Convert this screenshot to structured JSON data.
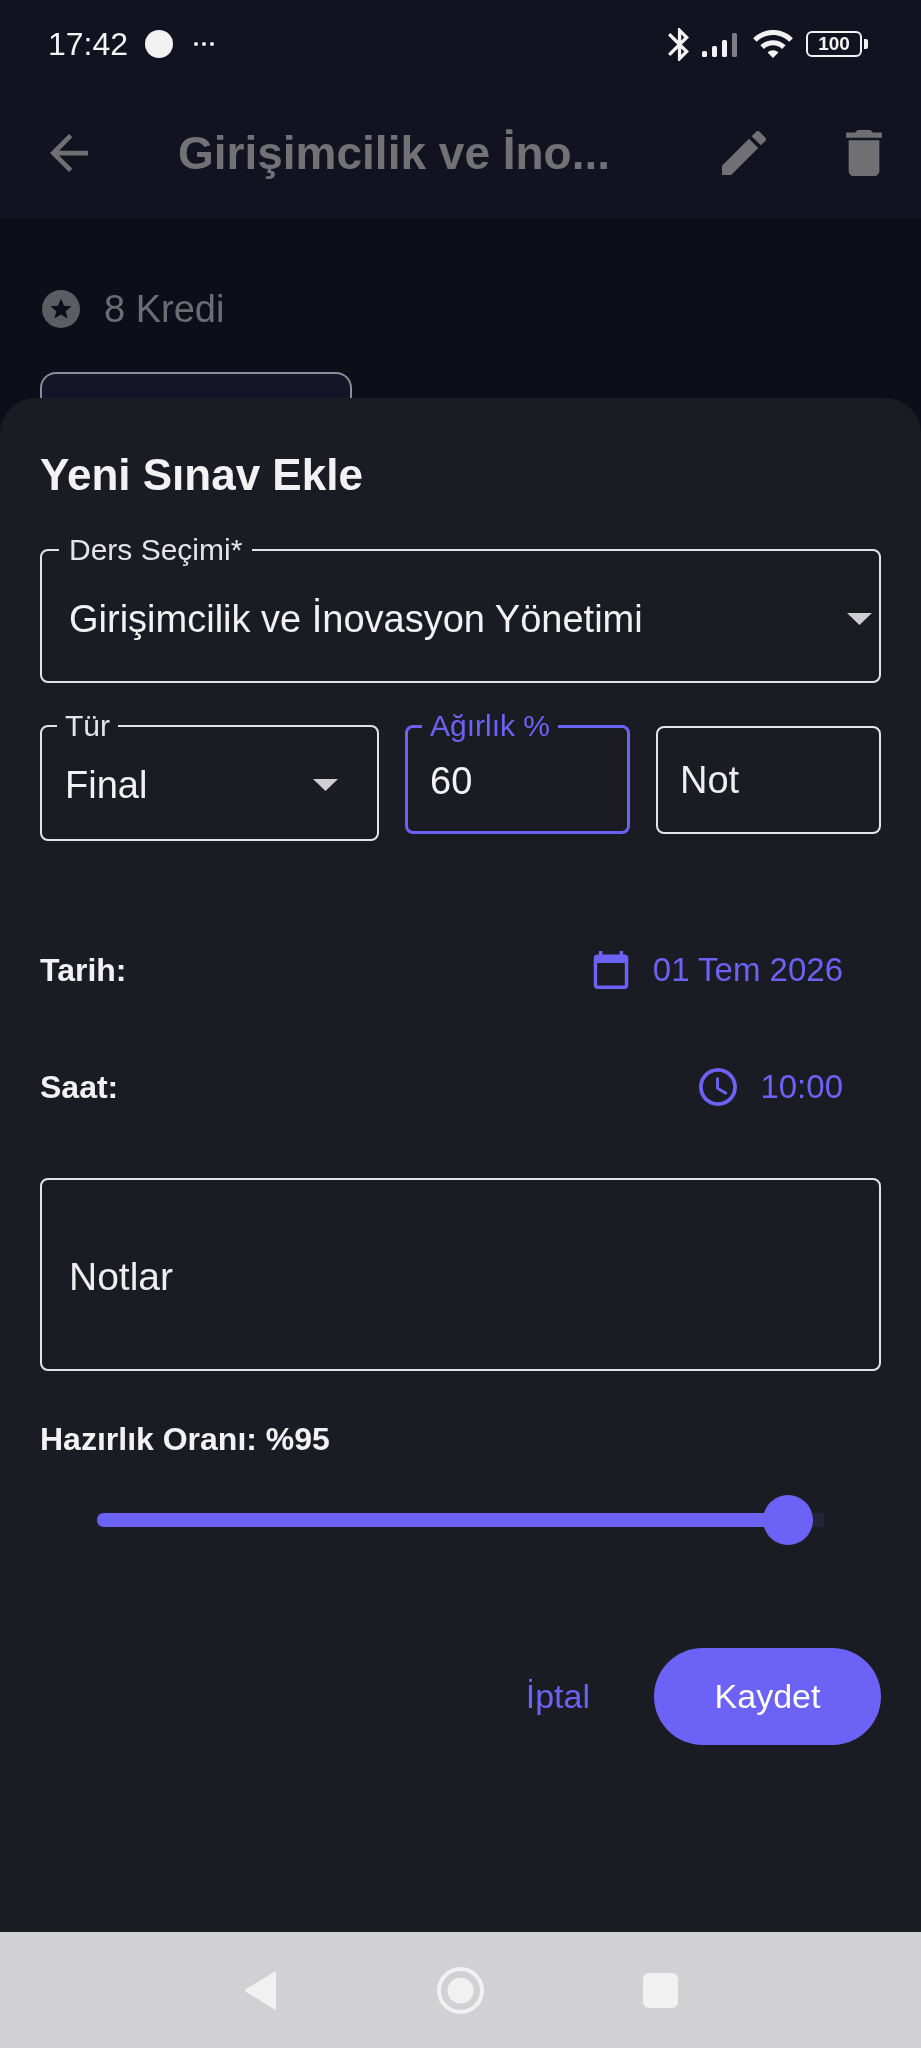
{
  "status_bar": {
    "time": "17:42",
    "battery": "100"
  },
  "app_bar": {
    "title": "Girişimcilik ve İno..."
  },
  "course_summary": {
    "credits": "8 Kredi"
  },
  "sheet": {
    "title": "Yeni Sınav Ekle",
    "course_field": {
      "label": "Ders Seçimi*",
      "value": "Girişimcilik ve İnovasyon Yönetimi"
    },
    "fields": [
      {
        "kind": "dropdown",
        "label": "Tür",
        "value": "Final",
        "focused": false
      },
      {
        "kind": "text",
        "label": "Ağırlık %",
        "value": "60",
        "focused": true
      },
      {
        "kind": "empty",
        "placeholder": "Not",
        "focused": false
      }
    ],
    "schedule": [
      {
        "kind": "date",
        "label": "Tarih:",
        "value": "01 Tem 2026"
      },
      {
        "kind": "time",
        "label": "Saat:",
        "value": "10:00"
      }
    ],
    "notes": {
      "placeholder": "Notlar"
    },
    "readiness": {
      "label": "Hazırlık Oranı: %95",
      "level": 0.95
    },
    "buttons": [
      {
        "kind": "text",
        "label": "İptal"
      },
      {
        "kind": "filled",
        "label": "Kaydet"
      }
    ]
  }
}
